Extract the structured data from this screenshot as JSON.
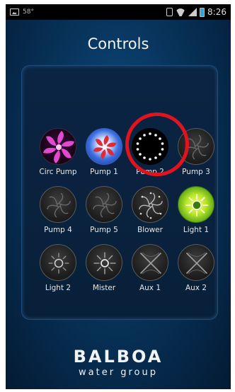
{
  "statusbar": {
    "left_text": "58°",
    "time": "8:26"
  },
  "screen": {
    "title": "Controls"
  },
  "controls": [
    {
      "label": "Circ Pump",
      "icon": "circ-pump-icon",
      "state": "active-pink"
    },
    {
      "label": "Pump 1",
      "icon": "pump-icon",
      "state": "active-red-blue"
    },
    {
      "label": "Pump 2",
      "icon": "pump-icon",
      "state": "selected-dots"
    },
    {
      "label": "Pump 3",
      "icon": "pump-icon",
      "state": "off"
    },
    {
      "label": "Pump 4",
      "icon": "pump-icon",
      "state": "off"
    },
    {
      "label": "Pump 5",
      "icon": "pump-icon",
      "state": "off"
    },
    {
      "label": "Blower",
      "icon": "blower-icon",
      "state": "off"
    },
    {
      "label": "Light 1",
      "icon": "light-icon",
      "state": "active-green"
    },
    {
      "label": "Light 2",
      "icon": "light-icon",
      "state": "off"
    },
    {
      "label": "Mister",
      "icon": "mister-icon",
      "state": "off"
    },
    {
      "label": "Aux 1",
      "icon": "aux-icon",
      "state": "off"
    },
    {
      "label": "Aux 2",
      "icon": "aux-icon",
      "state": "off"
    }
  ],
  "logo": {
    "main": "BALBOA",
    "sub": "water group"
  },
  "colors": {
    "highlight": "#e0141e",
    "background": "#08345c",
    "pink": "#e040c8",
    "green": "#b6e62a",
    "red": "#e02a3a",
    "blue": "#3b6fe0"
  }
}
